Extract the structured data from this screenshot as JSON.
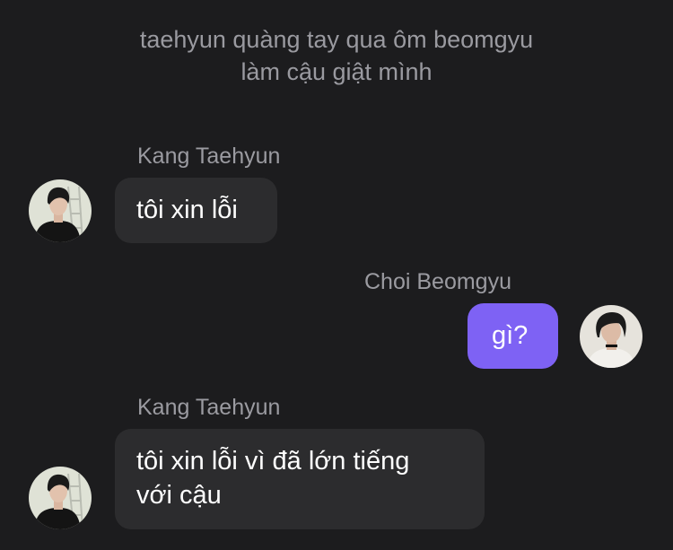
{
  "narration": {
    "line1": "taehyun quàng tay qua ôm beomgyu",
    "line2": "làm cậu giật mình"
  },
  "messages": [
    {
      "sender": "Kang Taehyun",
      "text": "tôi xin lỗi",
      "direction": "incoming",
      "avatar_icon": "taehyun-avatar"
    },
    {
      "sender": "Choi Beomgyu",
      "text": "gì?",
      "direction": "outgoing",
      "avatar_icon": "beomgyu-avatar"
    },
    {
      "sender": "Kang Taehyun",
      "text_line1": "tôi xin lỗi vì đã lớn tiếng",
      "text_line2": "với cậu",
      "direction": "incoming",
      "avatar_icon": "taehyun-avatar"
    }
  ],
  "colors": {
    "background": "#1c1c1e",
    "incoming_bubble": "#2c2c2e",
    "outgoing_bubble": "#7e62f4",
    "secondary_text": "#9b9ba1"
  }
}
